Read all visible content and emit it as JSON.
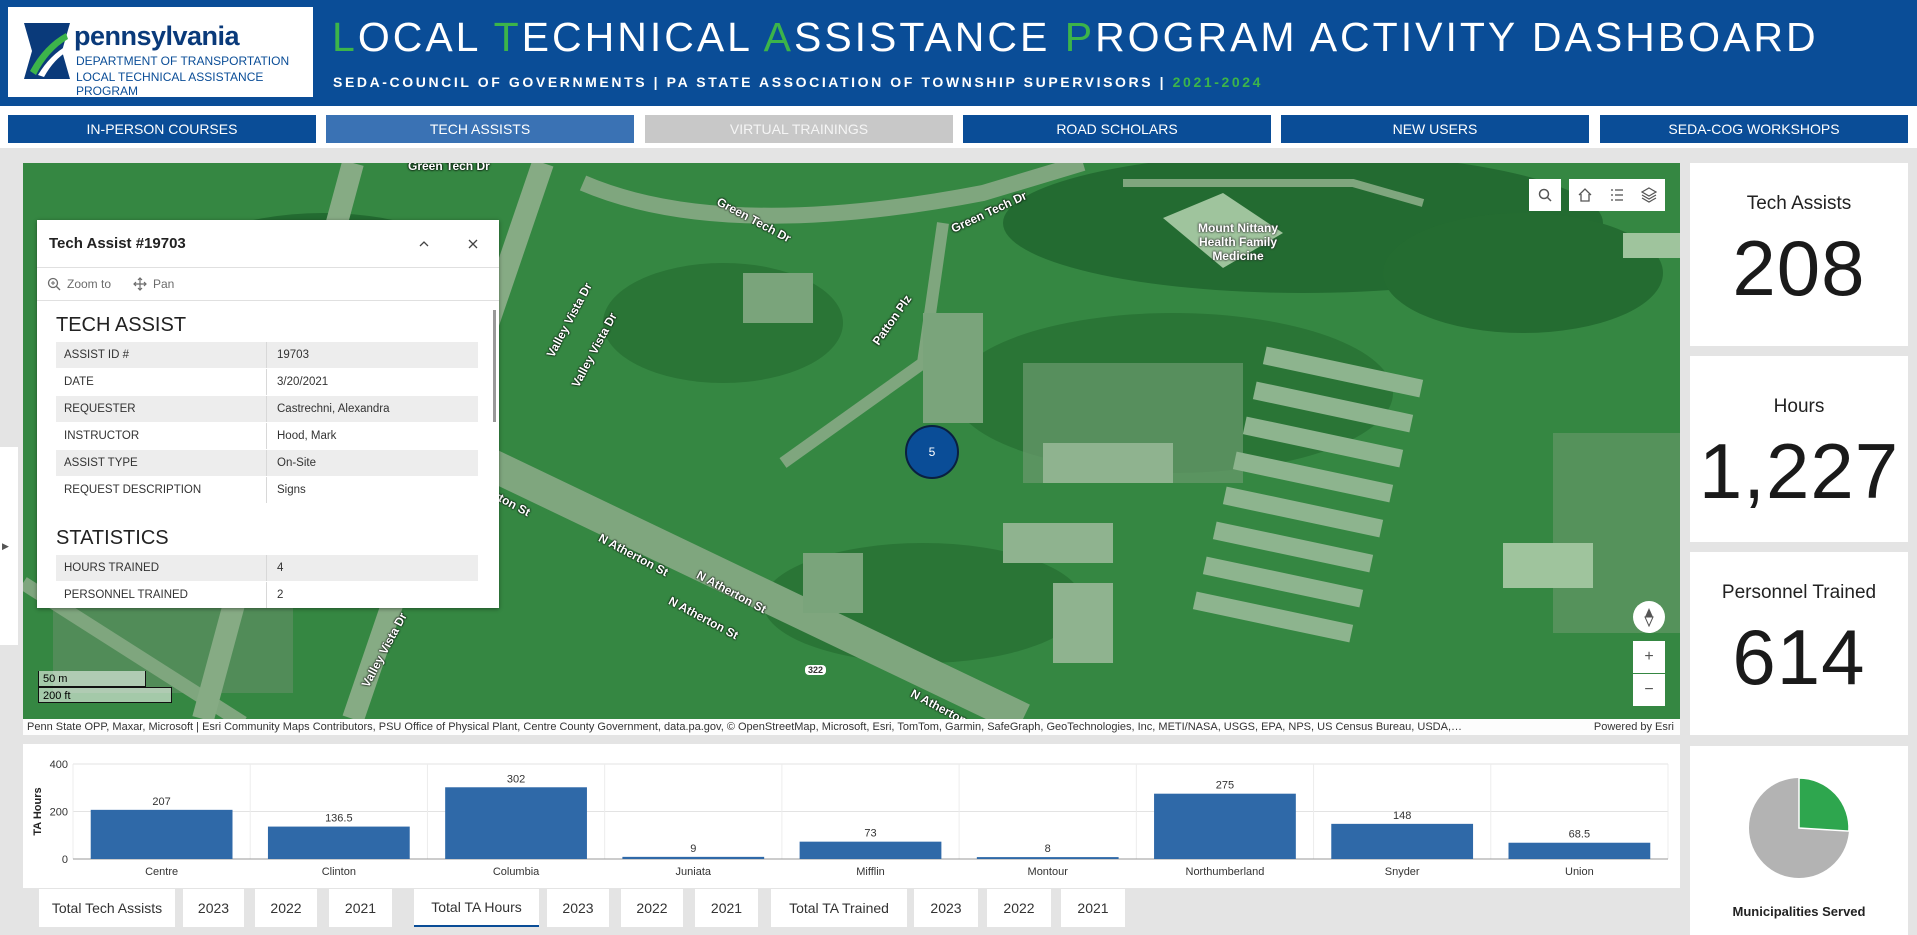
{
  "header": {
    "logo": {
      "state": "pennsylvania",
      "department": "DEPARTMENT OF TRANSPORTATION",
      "program": "LOCAL TECHNICAL ASSISTANCE PROGRAM"
    },
    "title_words": [
      {
        "cap": "L",
        "rest": "OCAL"
      },
      {
        "cap": "T",
        "rest": "ECHNICAL"
      },
      {
        "cap": "A",
        "rest": "SSISTANCE"
      },
      {
        "cap": "P",
        "rest": "ROGRAM ACTIVITY DASHBOARD"
      }
    ],
    "subtitle": "SEDA-COUNCIL OF GOVERNMENTS | PA STATE ASSOCIATION OF TOWNSHIP SUPERVISORS |",
    "subtitle_years": "2021-2024",
    "colors": {
      "brand_blue": "#0a4d97",
      "accent_green": "#3cb44a"
    }
  },
  "nav": {
    "items": [
      {
        "label": "IN-PERSON COURSES",
        "state": "normal"
      },
      {
        "label": "TECH ASSISTS",
        "state": "active"
      },
      {
        "label": "VIRTUAL TRAININGS",
        "state": "disabled"
      },
      {
        "label": "ROAD SCHOLARS",
        "state": "normal"
      },
      {
        "label": "NEW USERS",
        "state": "normal"
      },
      {
        "label": "SEDA-COG WORKSHOPS",
        "state": "normal"
      }
    ]
  },
  "map": {
    "labels": {
      "green_tech_1": "Green Tech Dr",
      "green_tech_2": "Green Tech Dr",
      "green_tech_3": "Green Tech Dr",
      "valley_vista_1": "Valley Vista Dr",
      "valley_vista_2": "Valley Vista Dr",
      "valley_vista_3": "Valley Vista Dr",
      "patton": "Patton Plz",
      "atherton_1": "N Atherton St",
      "atherton_2": "N Atherton St",
      "atherton_3": "N Atherton St",
      "atherton_4": "N Atherton",
      "atherton_st": "rton St",
      "route": "322",
      "poi": "Mount Nittany Health Family Medicine"
    },
    "cluster_count": "5",
    "tools": [
      "search-icon",
      "home-icon",
      "legend-icon",
      "layers-icon"
    ],
    "scale": {
      "metric": "50 m",
      "imperial": "200 ft"
    },
    "zoom": {
      "in": "+",
      "out": "−"
    },
    "attribution": "Penn State OPP, Maxar, Microsoft | Esri Community Maps Contributors, PSU Office of Physical Plant, Centre County Government, data.pa.gov, © OpenStreetMap, Microsoft, Esri, TomTom, Garmin, SafeGraph, GeoTechnologies, Inc, METI/NASA, USGS, EPA, NPS, US Census Bureau, USDA,…",
    "powered_by": "Powered by Esri"
  },
  "popup": {
    "title": "Tech Assist #19703",
    "actions": {
      "zoom": "Zoom to",
      "pan": "Pan"
    },
    "section1_title": "TECH ASSIST",
    "section1_rows": [
      {
        "k": "ASSIST ID #",
        "v": "19703"
      },
      {
        "k": "DATE",
        "v": "3/20/2021"
      },
      {
        "k": "REQUESTER",
        "v": "Castrechni, Alexandra"
      },
      {
        "k": "INSTRUCTOR",
        "v": "Hood, Mark"
      },
      {
        "k": "ASSIST TYPE",
        "v": "On-Site"
      },
      {
        "k": "REQUEST DESCRIPTION",
        "v": "Signs"
      }
    ],
    "section2_title": "STATISTICS",
    "section2_rows": [
      {
        "k": "HOURS TRAINED",
        "v": "4"
      },
      {
        "k": "PERSONNEL TRAINED",
        "v": "2"
      }
    ]
  },
  "stats": {
    "tech_assists": {
      "label": "Tech Assists",
      "value": "208"
    },
    "hours": {
      "label": "Hours",
      "value": "1,227"
    },
    "personnel": {
      "label": "Personnel Trained",
      "value": "614"
    }
  },
  "chart_data": {
    "type": "bar",
    "categories": [
      "Centre",
      "Clinton",
      "Columbia",
      "Juniata",
      "Mifflin",
      "Montour",
      "Northumberland",
      "Snyder",
      "Union"
    ],
    "values": [
      207,
      136.5,
      302,
      9,
      73,
      8,
      275,
      148,
      68.5
    ],
    "value_labels": [
      "207",
      "136.5",
      "302",
      "9",
      "73",
      "8",
      "275",
      "148",
      "68.5"
    ],
    "ylabel": "TA Hours",
    "yticks": [
      "400",
      "200",
      "0"
    ],
    "ylim": [
      0,
      400
    ],
    "bar_color": "#2f69a8",
    "grid": true
  },
  "chart_tabs": [
    {
      "label": "Total Tech Assists",
      "active": false
    },
    {
      "label": "2023",
      "active": false
    },
    {
      "label": "2022",
      "active": false
    },
    {
      "label": "2021",
      "active": false
    },
    {
      "label": "Total TA Hours",
      "active": true
    },
    {
      "label": "2023",
      "active": false
    },
    {
      "label": "2022",
      "active": false
    },
    {
      "label": "2021",
      "active": false
    },
    {
      "label": "Total TA Trained",
      "active": false
    },
    {
      "label": "2023",
      "active": false
    },
    {
      "label": "2022",
      "active": false
    },
    {
      "label": "2021",
      "active": false
    }
  ],
  "pie": {
    "title": "Municipalities Served",
    "served_fraction": 0.26,
    "colors": {
      "served": "#2ea64e",
      "other": "#b3b3b3"
    }
  }
}
